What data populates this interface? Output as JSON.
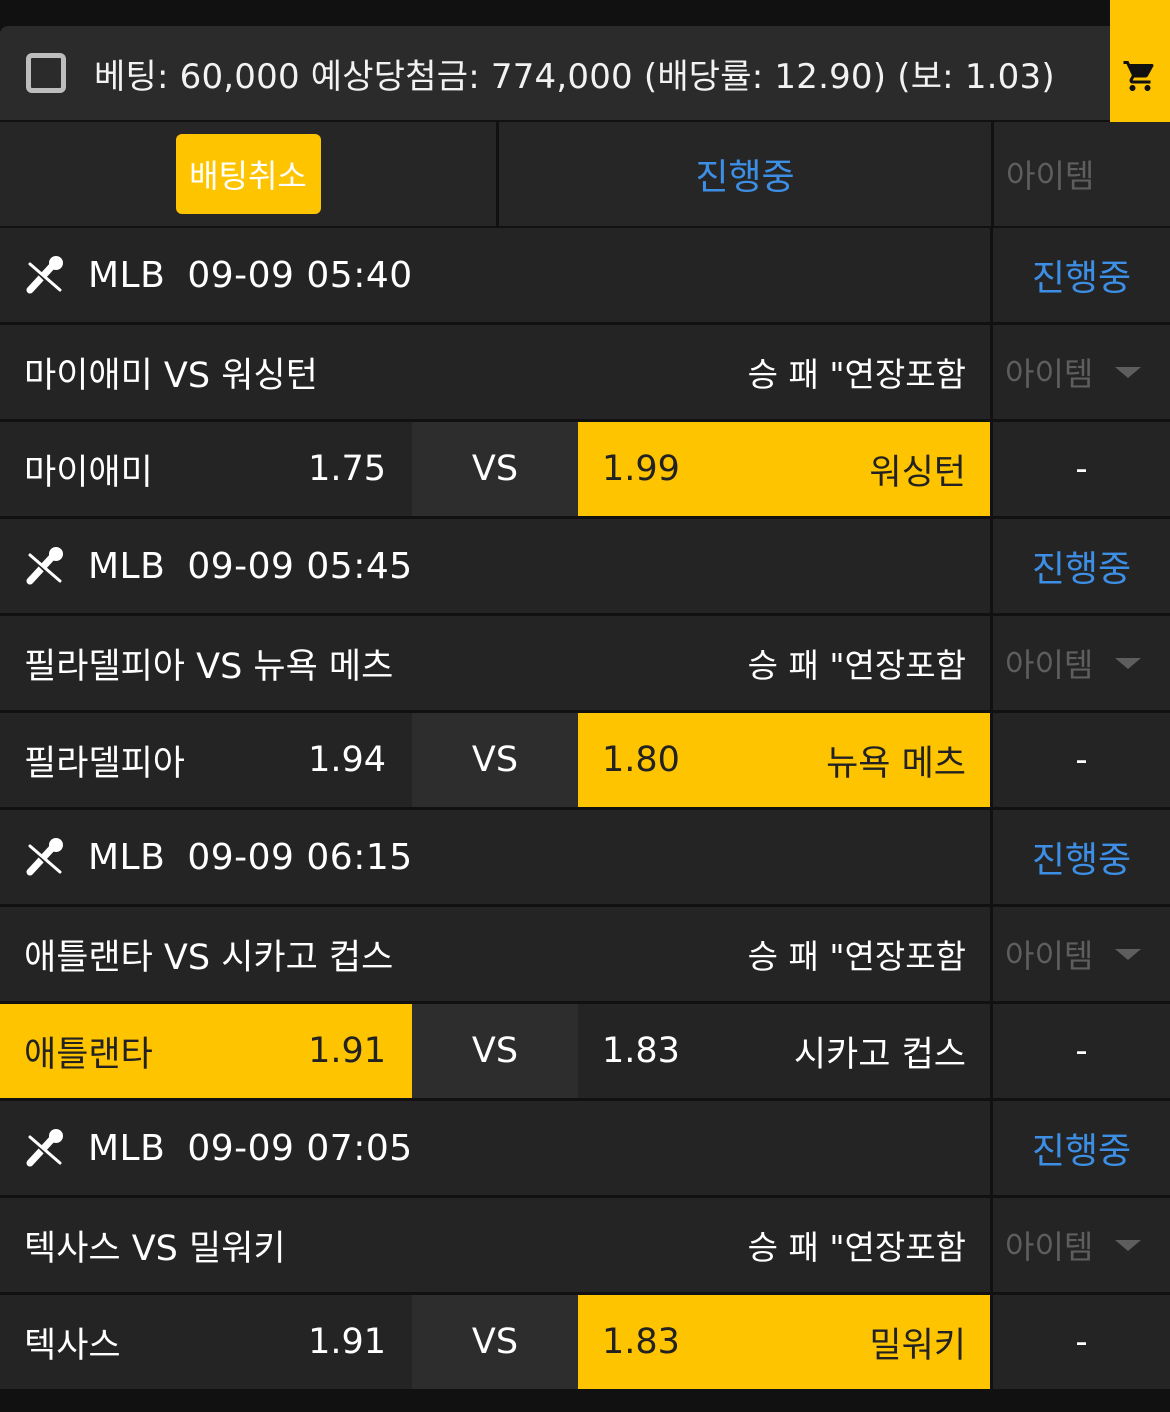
{
  "summary": {
    "text": "베팅: 60,000 예상당첨금: 774,000 (배당률: 12.90) (보: 1.03)"
  },
  "actions": {
    "cancel_label": "배팅취소",
    "status_label": "진행중",
    "item_label": "아이템"
  },
  "colors": {
    "accent": "#ffc400",
    "status_blue": "#3d8fe6",
    "muted": "#5e5e5e"
  },
  "games": [
    {
      "league": "MLB",
      "datetime": "09-09 05:40",
      "status": "진행중",
      "title": "마이애미 VS 워싱턴",
      "bet_type": "승 패 \"연장포함",
      "item": "아이템",
      "home_team": "마이애미",
      "home_odds": "1.75",
      "vs": "VS",
      "away_odds": "1.99",
      "away_team": "워싱턴",
      "selected": "away",
      "result": "-"
    },
    {
      "league": "MLB",
      "datetime": "09-09 05:45",
      "status": "진행중",
      "title": "필라델피아 VS 뉴욕 메츠",
      "bet_type": "승 패 \"연장포함",
      "item": "아이템",
      "home_team": "필라델피아",
      "home_odds": "1.94",
      "vs": "VS",
      "away_odds": "1.80",
      "away_team": "뉴욕 메츠",
      "selected": "away",
      "result": "-"
    },
    {
      "league": "MLB",
      "datetime": "09-09 06:15",
      "status": "진행중",
      "title": "애틀랜타 VS 시카고 컵스",
      "bet_type": "승 패 \"연장포함",
      "item": "아이템",
      "home_team": "애틀랜타",
      "home_odds": "1.91",
      "vs": "VS",
      "away_odds": "1.83",
      "away_team": "시카고 컵스",
      "selected": "home",
      "result": "-"
    },
    {
      "league": "MLB",
      "datetime": "09-09 07:05",
      "status": "진행중",
      "title": "텍사스 VS 밀워키",
      "bet_type": "승 패 \"연장포함",
      "item": "아이템",
      "home_team": "텍사스",
      "home_odds": "1.91",
      "vs": "VS",
      "away_odds": "1.83",
      "away_team": "밀워키",
      "selected": "away",
      "result": "-"
    }
  ]
}
